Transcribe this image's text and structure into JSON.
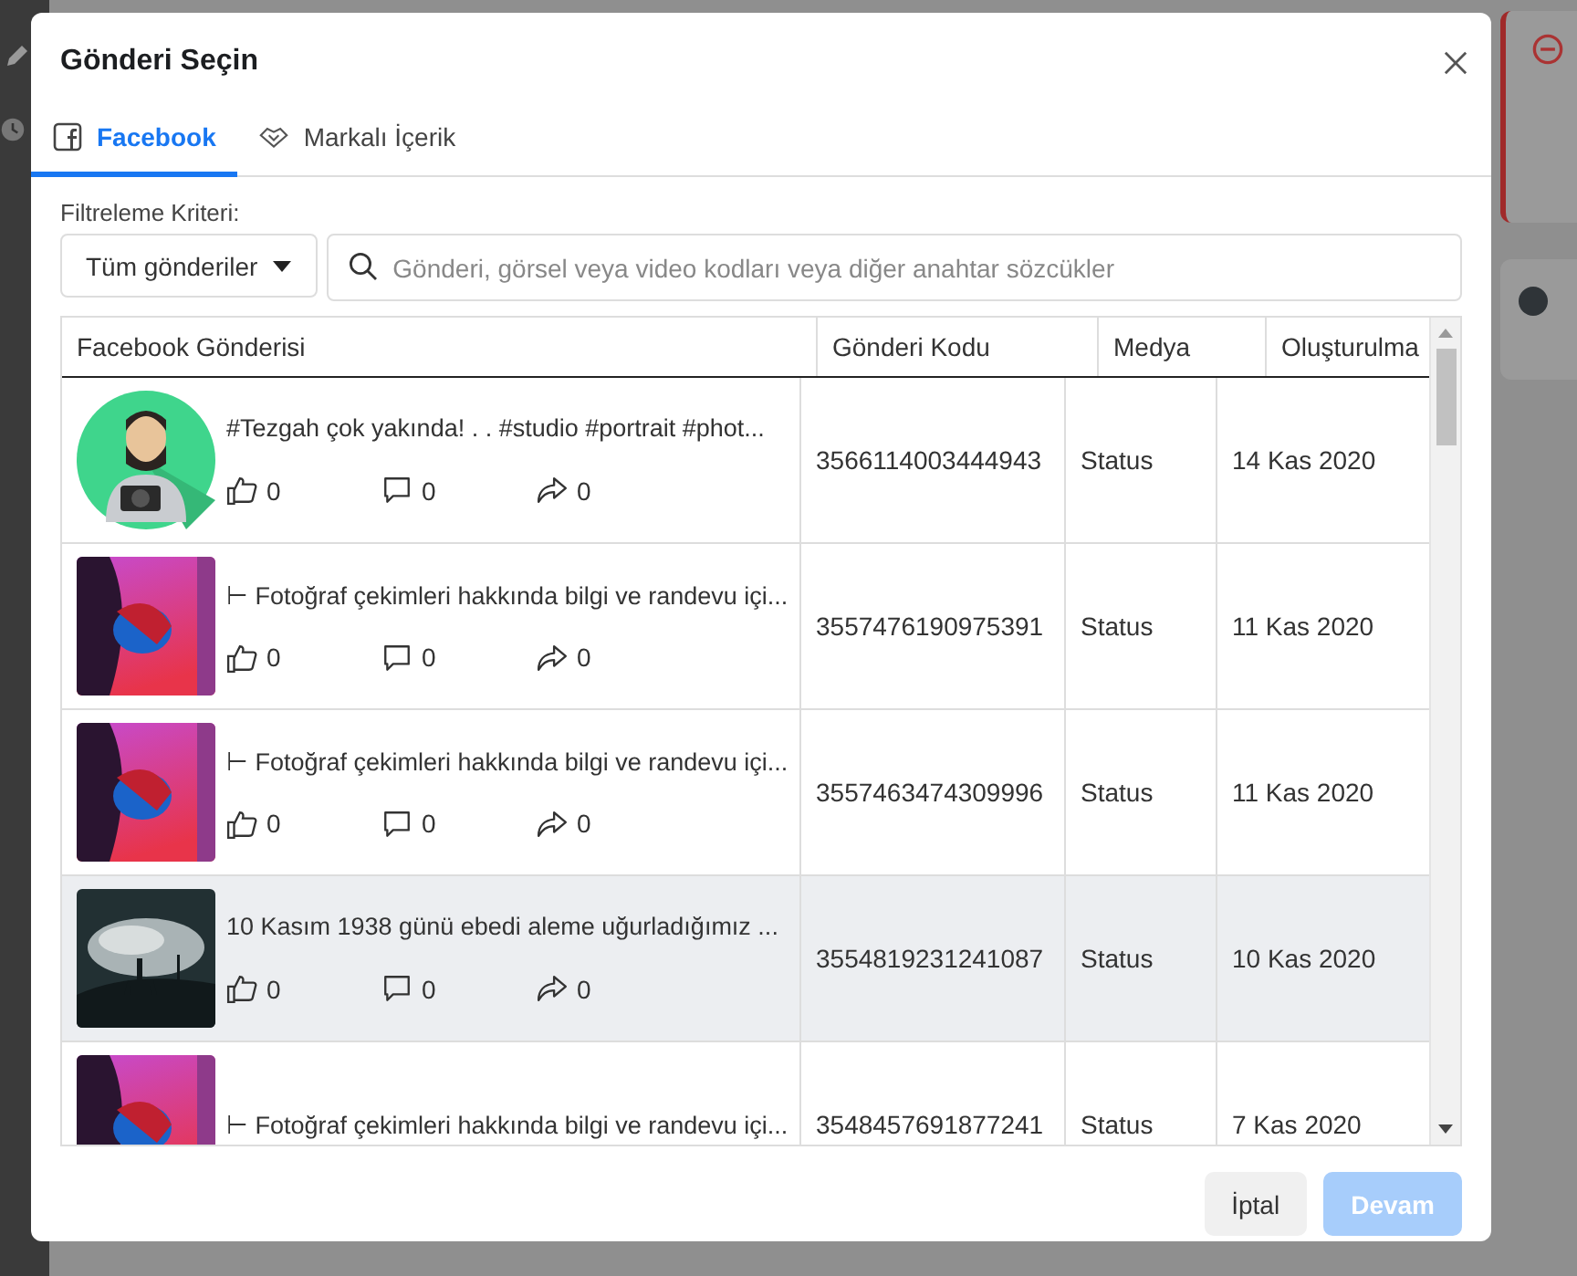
{
  "dialog": {
    "title": "Gönderi Seçin"
  },
  "background": {
    "toggle_on": false
  },
  "tabs": [
    {
      "label": "Facebook",
      "selected": true
    },
    {
      "label": "Markalı İçerik",
      "selected": false
    }
  ],
  "filter": {
    "label": "Filtreleme Kriteri:",
    "dropdown": "Tüm gönderiler",
    "search_placeholder": "Gönderi, görsel veya video kodları veya diğer anahtar sözcükler"
  },
  "table": {
    "columns": [
      "Facebook Gönderisi",
      "Gönderi Kodu",
      "Medya",
      "Oluşturulma"
    ],
    "rows": [
      {
        "text": "#Tezgah çok yakında! . . #studio #portrait #phot...",
        "reactions": {
          "likes": "0",
          "comments": "0",
          "shares": "0"
        },
        "code": "3566114003444943",
        "media": "Status",
        "date": "14 Kas 2020",
        "selected": false
      },
      {
        "text": "⊢ Fotoğraf çekimleri hakkında bilgi ve randevu içi...",
        "reactions": {
          "likes": "0",
          "comments": "0",
          "shares": "0"
        },
        "code": "3557476190975391",
        "media": "Status",
        "date": "11 Kas 2020",
        "selected": false
      },
      {
        "text": "⊢ Fotoğraf çekimleri hakkında bilgi ve randevu içi...",
        "reactions": {
          "likes": "0",
          "comments": "0",
          "shares": "0"
        },
        "code": "3557463474309996",
        "media": "Status",
        "date": "11 Kas 2020",
        "selected": false
      },
      {
        "text": "10 Kasım 1938 günü ebedi aleme uğurladığımız ...",
        "reactions": {
          "likes": "0",
          "comments": "0",
          "shares": "0"
        },
        "code": "3554819231241087",
        "media": "Status",
        "date": "10 Kas 2020",
        "selected": true
      },
      {
        "text": "⊢ Fotoğraf çekimleri hakkında bilgi ve randevu içi...",
        "code": "3548457691877241",
        "media": "Status",
        "date": "7 Kas 2020",
        "selected": false
      }
    ]
  },
  "buttons": [
    {
      "label": "İptal",
      "kind": "secondary",
      "disabled": false
    },
    {
      "label": "Devam",
      "kind": "primary",
      "disabled": true
    }
  ]
}
